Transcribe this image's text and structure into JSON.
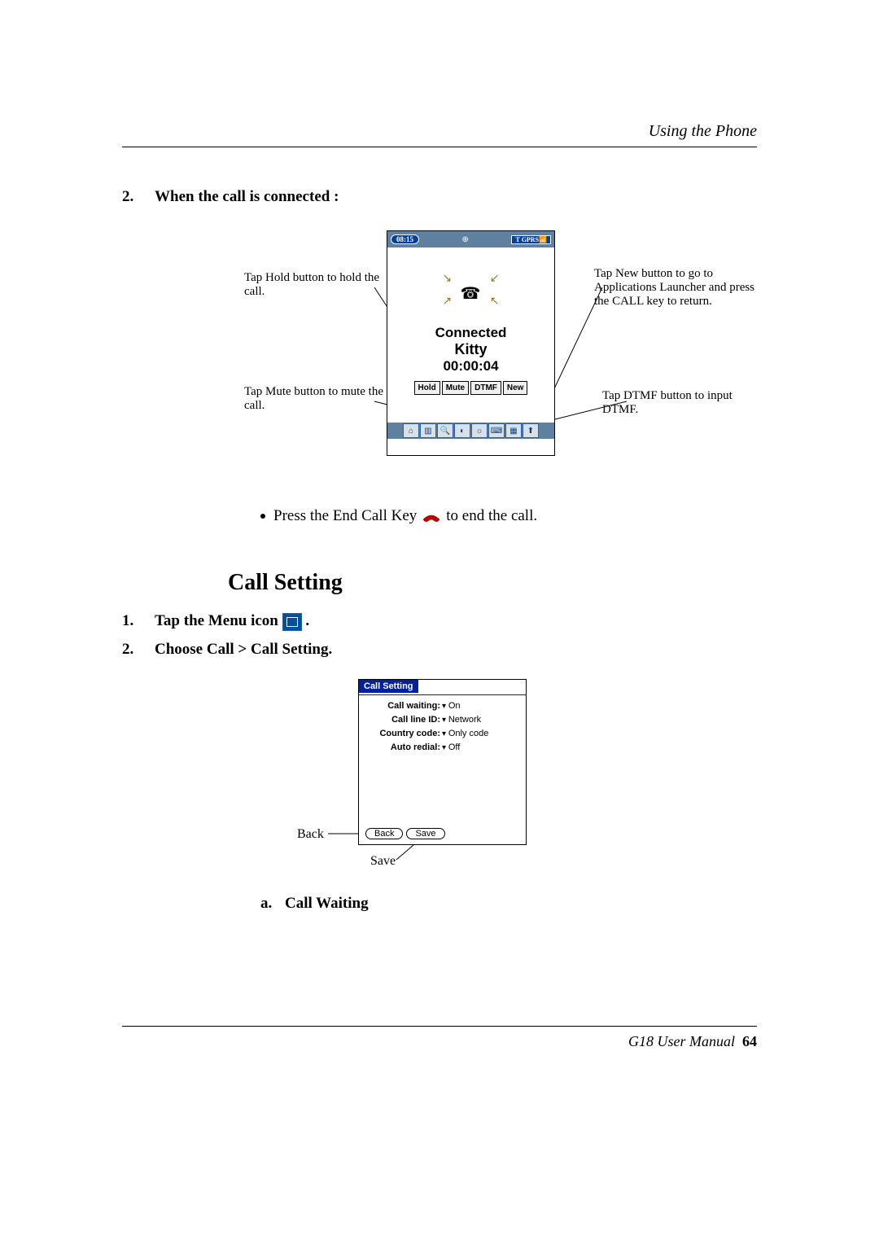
{
  "header": {
    "title": "Using the Phone"
  },
  "section2": {
    "num": "2.",
    "title": "When the call is connected :"
  },
  "callouts": {
    "hold": "Tap Hold button to hold the call.",
    "mute": "Tap Mute button to mute the call.",
    "new": "Tap New button to go to Applications Launcher and press the CALL key to return.",
    "dtmf": "Tap DTMF button to input DTMF."
  },
  "screenshot1": {
    "time": "08:15",
    "gprs": "GPRS",
    "connected": "Connected",
    "name": "Kitty",
    "timer": "00:00:04",
    "buttons": {
      "hold": "Hold",
      "mute": "Mute",
      "dtmf": "DTMF",
      "newb": "New"
    }
  },
  "bullet": {
    "pre": "Press the End Call Key",
    "post": " to end the call."
  },
  "h2": "Call Setting",
  "step1": {
    "num": "1.",
    "text": "Tap the Menu icon ",
    "suffix": " ."
  },
  "step2": {
    "num": "2.",
    "text": "Choose Call > Call Setting."
  },
  "screenshot2": {
    "tab": "Call Setting",
    "rows": {
      "r1": {
        "label": "Call waiting:",
        "value": "On"
      },
      "r2": {
        "label": "Call line ID:",
        "value": "Network"
      },
      "r3": {
        "label": "Country code:",
        "value": "Only code"
      },
      "r4": {
        "label": "Auto redial:",
        "value": "Off"
      }
    },
    "btns": {
      "back": "Back",
      "save": "Save"
    },
    "ann": {
      "back": "Back",
      "save": "Save"
    }
  },
  "sub_a": {
    "let": "a.",
    "text": "Call Waiting"
  },
  "footer": {
    "text": "G18 User Manual",
    "page": "64"
  }
}
